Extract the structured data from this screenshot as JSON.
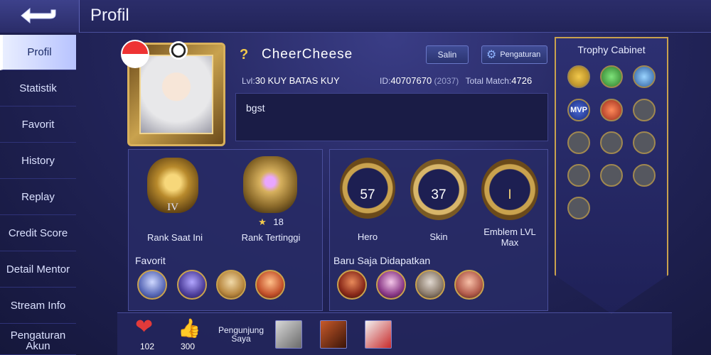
{
  "header": {
    "title": "Profil"
  },
  "sidebar": {
    "items": [
      {
        "label": "Profil",
        "active": true
      },
      {
        "label": "Statistik"
      },
      {
        "label": "Favorit"
      },
      {
        "label": "History"
      },
      {
        "label": "Replay"
      },
      {
        "label": "Credit Score"
      },
      {
        "label": "Detail Mentor"
      },
      {
        "label": "Stream Info"
      },
      {
        "label": "Pengaturan Akun"
      }
    ]
  },
  "profile": {
    "unknown_mark": "?",
    "username": "CheerCheese",
    "copy_label": "Salin",
    "settings_label": "Pengaturan",
    "level_prefix": "Lvl:",
    "level": "30",
    "squad_tag": "KUY",
    "squad_name": "BATAS KUY",
    "id_prefix": "ID:",
    "id": "40707670",
    "server": "(2037)",
    "total_match_prefix": "Total Match:",
    "total_match": "4726",
    "bio": "bgst"
  },
  "ranks": {
    "current_tier": "IV",
    "current_label": "Rank Saat Ini",
    "highest_stars": "18",
    "highest_label": "Rank Tertinggi"
  },
  "collection": {
    "hero_count": "57",
    "hero_label": "Hero",
    "skin_count": "37",
    "skin_label": "Skin",
    "emblem_level": "I",
    "emblem_label": "Emblem LVL Max"
  },
  "favorites": {
    "label": "Favorit"
  },
  "recent": {
    "label": "Baru Saja Didapatkan"
  },
  "trophy": {
    "title": "Trophy Cabinet",
    "mvp_label": "MVP"
  },
  "bottom": {
    "likes": "102",
    "thumbs": "300",
    "visitors_label": "Pengunjung Saya"
  },
  "colors": {
    "accent_gold": "#c9a24e",
    "panel": "#282b66",
    "bg": "#1f2150"
  }
}
